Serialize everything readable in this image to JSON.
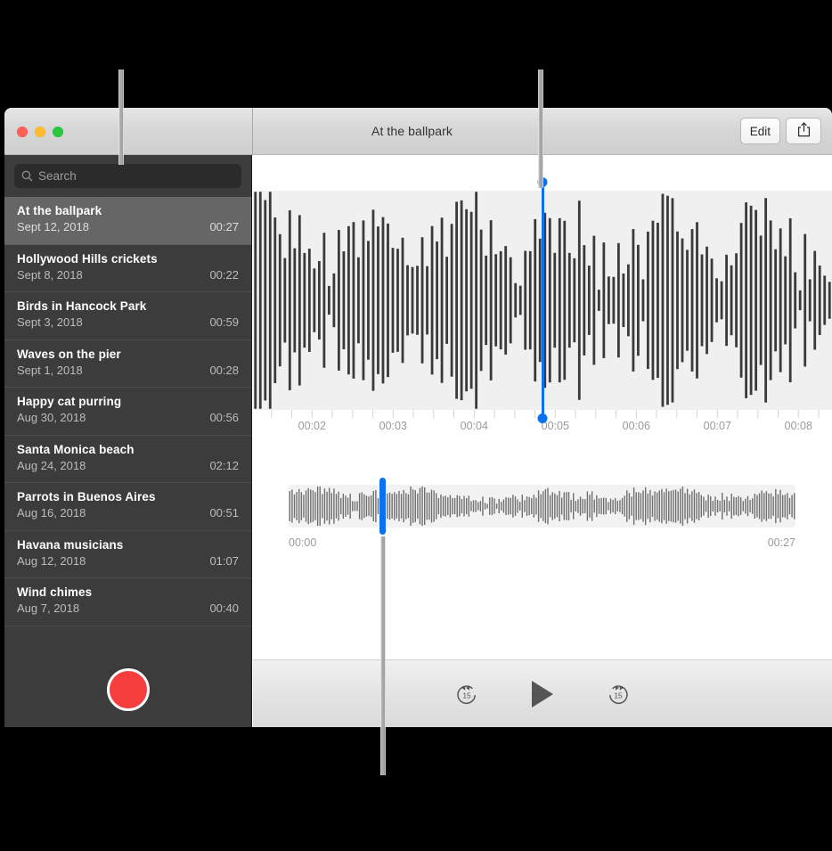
{
  "window": {
    "title": "At the ballpark",
    "traffic_lights": [
      "close",
      "minimize",
      "zoom"
    ]
  },
  "toolbar": {
    "edit_label": "Edit",
    "share_icon": "share-icon"
  },
  "sidebar": {
    "search": {
      "placeholder": "Search",
      "value": "",
      "icon": "search-icon"
    },
    "memos": [
      {
        "title": "At the ballpark",
        "date": "Sept 12, 2018",
        "duration": "00:27",
        "selected": true
      },
      {
        "title": "Hollywood Hills crickets",
        "date": "Sept 8, 2018",
        "duration": "00:22",
        "selected": false
      },
      {
        "title": "Birds in Hancock Park",
        "date": "Sept 3, 2018",
        "duration": "00:59",
        "selected": false
      },
      {
        "title": "Waves on the pier",
        "date": "Sept 1, 2018",
        "duration": "00:28",
        "selected": false
      },
      {
        "title": "Happy cat purring",
        "date": "Aug 30, 2018",
        "duration": "00:56",
        "selected": false
      },
      {
        "title": "Santa Monica beach",
        "date": "Aug 24, 2018",
        "duration": "02:12",
        "selected": false
      },
      {
        "title": "Parrots in Buenos Aires",
        "date": "Aug 16, 2018",
        "duration": "00:51",
        "selected": false
      },
      {
        "title": "Havana musicians",
        "date": "Aug 12, 2018",
        "duration": "01:07",
        "selected": false
      },
      {
        "title": "Wind chimes",
        "date": "Aug 7, 2018",
        "duration": "00:40",
        "selected": false
      }
    ],
    "record_button": {
      "icon": "record-icon",
      "color": "#f63e3e"
    }
  },
  "detail": {
    "ruler": {
      "labels": [
        "00:02",
        "00:03",
        "00:04",
        "00:05",
        "00:06",
        "00:07",
        "00:08"
      ],
      "label_positions_pct": [
        10.2,
        24.2,
        38.2,
        52.2,
        66.2,
        80.2,
        94.2
      ]
    },
    "playhead": {
      "position_pct": 50.0,
      "color": "#0a72f0"
    },
    "overview": {
      "start_time": "00:00",
      "end_time": "00:27",
      "playhead_pct": 18.5
    },
    "current_time": "00:05.04",
    "controls": {
      "skip_back_label": "15",
      "skip_back_icon": "skip-back-15-icon",
      "play_icon": "play-icon",
      "skip_forward_label": "15",
      "skip_forward_icon": "skip-forward-15-icon"
    }
  },
  "callouts": [
    {
      "name": "sidebar-callout"
    },
    {
      "name": "playhead-callout"
    },
    {
      "name": "overview-callout"
    }
  ]
}
